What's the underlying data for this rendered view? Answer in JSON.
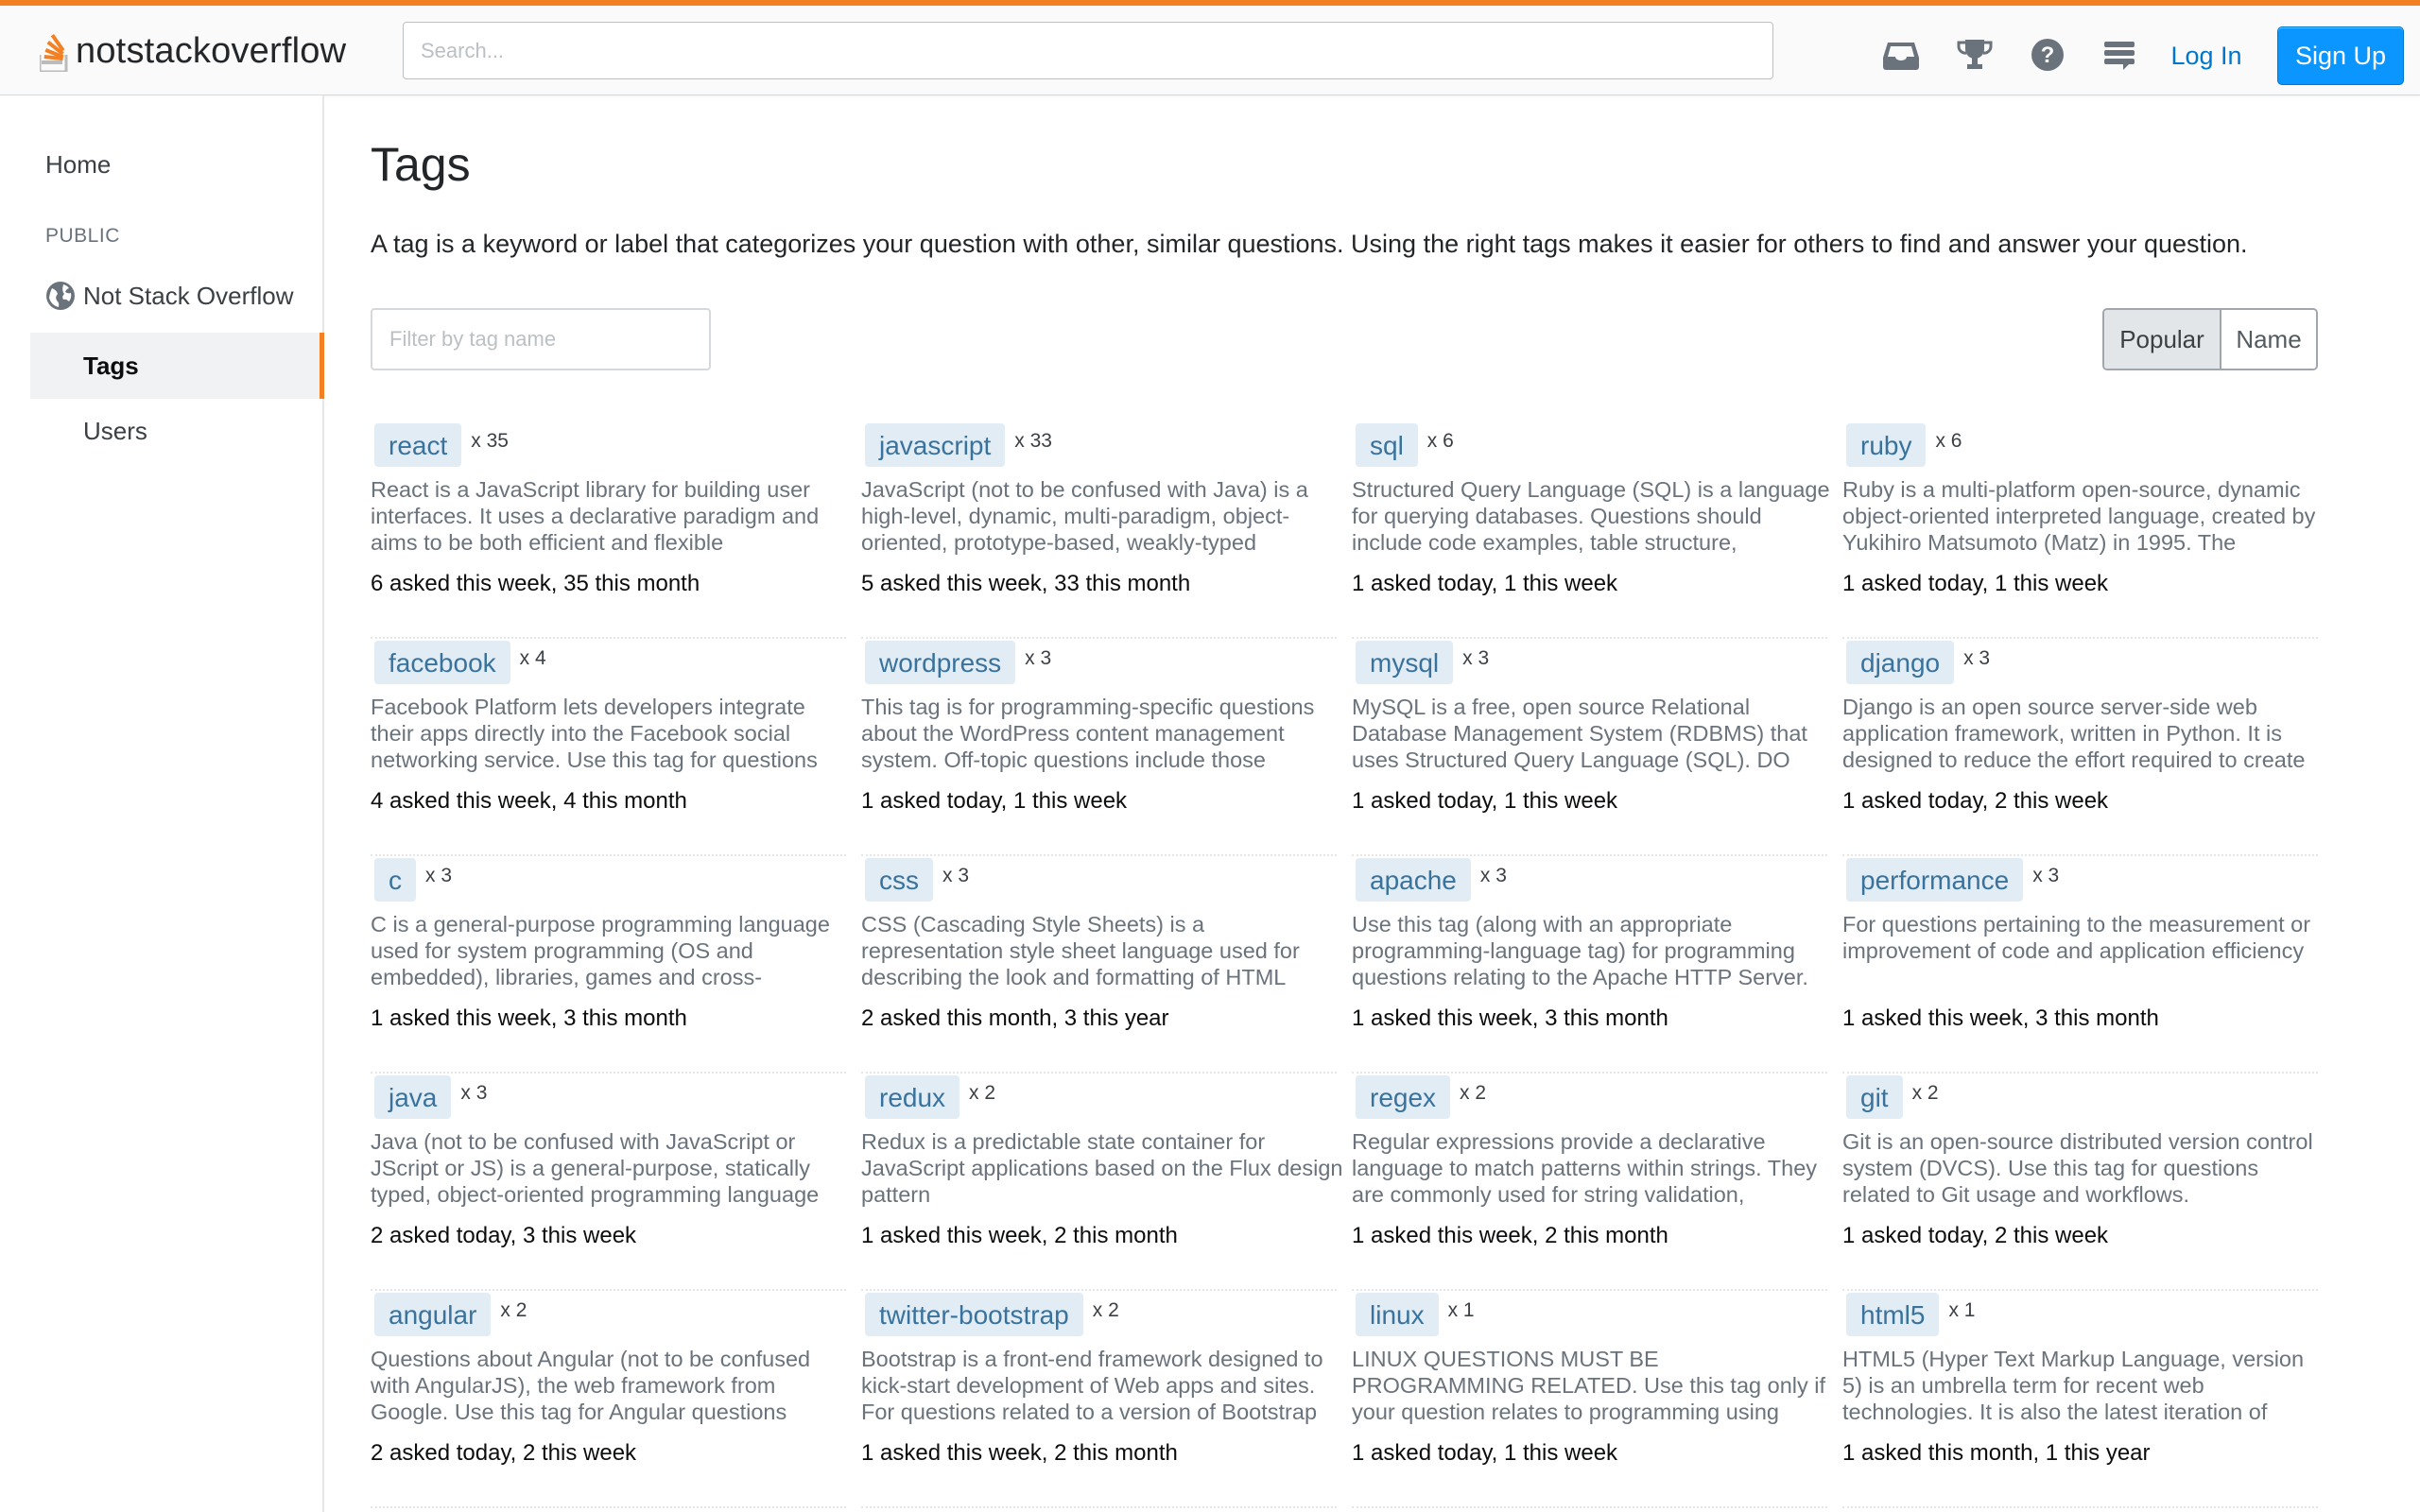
{
  "header": {
    "logo_prefix": "not",
    "logo_main": "stackoverflow",
    "search_placeholder": "Search...",
    "login_label": "Log In",
    "signup_label": "Sign Up",
    "icons": [
      "inbox-icon",
      "trophy-icon",
      "help-icon",
      "site-switcher-icon"
    ],
    "accent_color": "#f48024",
    "signup_color": "#0a95ff"
  },
  "sidebar": {
    "home": "Home",
    "section": "PUBLIC",
    "site": "Not Stack Overflow",
    "tags": "Tags",
    "users": "Users"
  },
  "main": {
    "title": "Tags",
    "description": "A tag is a keyword or label that categorizes your question with other, similar questions. Using the right tags makes it easier for others to find and answer your question.",
    "filter_placeholder": "Filter by tag name",
    "sort": {
      "popular": "Popular",
      "name": "Name",
      "selected": "Popular"
    },
    "tags": [
      {
        "name": "react",
        "count": "x 35",
        "excerpt": "React is a JavaScript library for building user interfaces. It uses a declarative paradigm and aims to be both efficient and flexible",
        "stats": "6 asked this week, 35 this month"
      },
      {
        "name": "javascript",
        "count": "x 33",
        "excerpt": "JavaScript (not to be confused with Java) is a high-level, dynamic, multi-paradigm, object-oriented, prototype-based, weakly-typed",
        "stats": "5 asked this week, 33 this month"
      },
      {
        "name": "sql",
        "count": "x 6",
        "excerpt": "Structured Query Language (SQL) is a language for querying databases. Questions should include code examples, table structure,",
        "stats": "1 asked today, 1 this week"
      },
      {
        "name": "ruby",
        "count": "x 6",
        "excerpt": "Ruby is a multi-platform open-source, dynamic object-oriented interpreted language, created by Yukihiro Matsumoto (Matz) in 1995. The",
        "stats": "1 asked today, 1 this week"
      },
      {
        "name": "facebook",
        "count": "x 4",
        "excerpt": "Facebook Platform lets developers integrate their apps directly into the Facebook social networking service. Use this tag for questions",
        "stats": "4 asked this week, 4 this month"
      },
      {
        "name": "wordpress",
        "count": "x 3",
        "excerpt": "This tag is for programming-specific questions about the WordPress content management system. Off-topic questions include those",
        "stats": "1 asked today, 1 this week"
      },
      {
        "name": "mysql",
        "count": "x 3",
        "excerpt": "MySQL is a free, open source Relational Database Management System (RDBMS) that uses Structured Query Language (SQL). DO",
        "stats": "1 asked today, 1 this week"
      },
      {
        "name": "django",
        "count": "x 3",
        "excerpt": "Django is an open source server-side web application framework, written in Python. It is designed to reduce the effort required to create",
        "stats": "1 asked today, 2 this week"
      },
      {
        "name": "c",
        "count": "x 3",
        "excerpt": "C is a general-purpose programming language used for system programming (OS and embedded), libraries, games and cross-",
        "stats": "1 asked this week, 3 this month"
      },
      {
        "name": "css",
        "count": "x 3",
        "excerpt": "CSS (Cascading Style Sheets) is a representation style sheet language used for describing the look and formatting of HTML",
        "stats": "2 asked this month, 3 this year"
      },
      {
        "name": "apache",
        "count": "x 3",
        "excerpt": "Use this tag (along with an appropriate programming-language tag) for programming questions relating to the Apache HTTP Server.",
        "stats": "1 asked this week, 3 this month"
      },
      {
        "name": "performance",
        "count": "x 3",
        "excerpt": "For questions pertaining to the measurement or improvement of code and application efficiency",
        "stats": "1 asked this week, 3 this month"
      },
      {
        "name": "java",
        "count": "x 3",
        "excerpt": "Java (not to be confused with JavaScript or JScript or JS) is a general-purpose, statically typed, object-oriented programming language",
        "stats": "2 asked today, 3 this week"
      },
      {
        "name": "redux",
        "count": "x 2",
        "excerpt": "Redux is a predictable state container for JavaScript applications based on the Flux design pattern",
        "stats": "1 asked this week, 2 this month"
      },
      {
        "name": "regex",
        "count": "x 2",
        "excerpt": "Regular expressions provide a declarative language to match patterns within strings. They are commonly used for string validation,",
        "stats": "1 asked this week, 2 this month"
      },
      {
        "name": "git",
        "count": "x 2",
        "excerpt": "Git is an open-source distributed version control system (DVCS). Use this tag for questions related to Git usage and workflows.",
        "stats": "1 asked today, 2 this week"
      },
      {
        "name": "angular",
        "count": "x 2",
        "excerpt": "Questions about Angular (not to be confused with AngularJS), the web framework from Google. Use this tag for Angular questions",
        "stats": "2 asked today, 2 this week"
      },
      {
        "name": "twitter-bootstrap",
        "count": "x 2",
        "excerpt": "Bootstrap is a front-end framework designed to kick-start development of Web apps and sites. For questions related to a version of Bootstrap",
        "stats": "1 asked this week, 2 this month"
      },
      {
        "name": "linux",
        "count": "x 1",
        "excerpt": "LINUX QUESTIONS MUST BE PROGRAMMING RELATED. Use this tag only if your question relates to programming using",
        "stats": "1 asked today, 1 this week"
      },
      {
        "name": "html5",
        "count": "x 1",
        "excerpt": "HTML5 (Hyper Text Markup Language, version 5) is an umbrella term for recent web technologies. It is also the latest iteration of",
        "stats": "1 asked this month, 1 this year"
      }
    ]
  }
}
